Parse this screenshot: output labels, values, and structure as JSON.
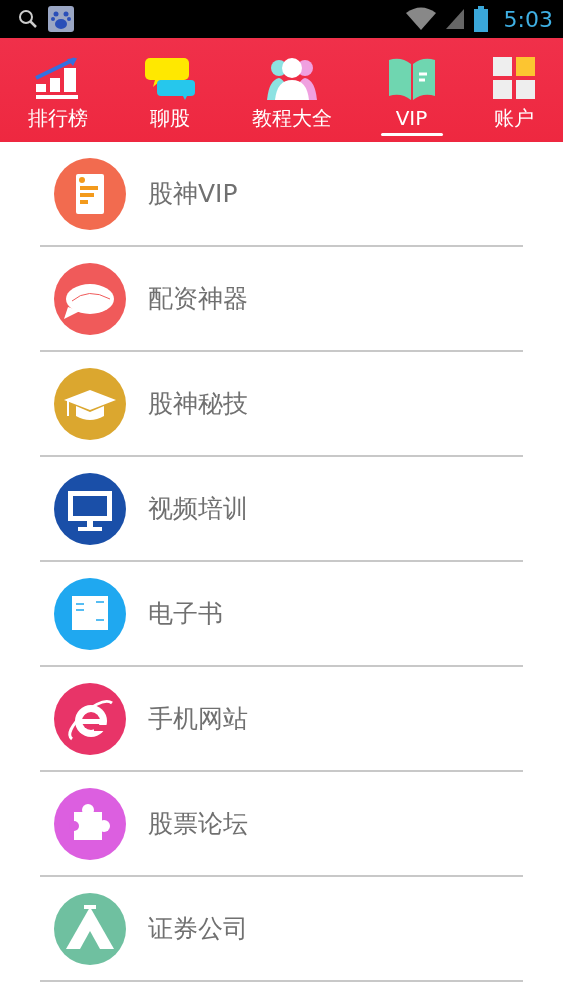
{
  "status_bar": {
    "time": "5:03"
  },
  "tabs": [
    {
      "label": "排行榜",
      "selected": false
    },
    {
      "label": "聊股",
      "selected": false
    },
    {
      "label": "教程大全",
      "selected": false
    },
    {
      "label": "VIP",
      "selected": true
    },
    {
      "label": "账户",
      "selected": false
    }
  ],
  "menu": [
    {
      "label": "股神VIP",
      "color": "#f26b4f"
    },
    {
      "label": "配资神器",
      "color": "#f05a5a"
    },
    {
      "label": "股神秘技",
      "color": "#dba72f"
    },
    {
      "label": "视频培训",
      "color": "#1a4fa8"
    },
    {
      "label": "电子书",
      "color": "#1fa8f0"
    },
    {
      "label": "手机网站",
      "color": "#e83468"
    },
    {
      "label": "股票论坛",
      "color": "#dc5fe0"
    },
    {
      "label": "证券公司",
      "color": "#6fc0a0"
    }
  ]
}
